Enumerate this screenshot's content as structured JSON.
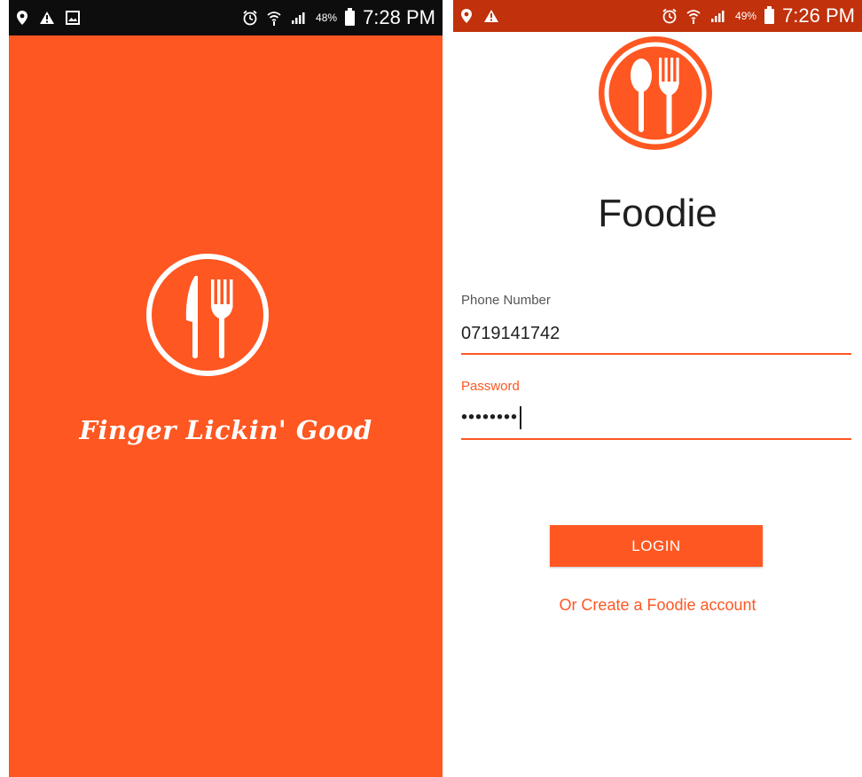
{
  "colors": {
    "accent": "#fe5722",
    "status_bar_dark": "#0d0d0d",
    "status_bar_accent": "#c0310c",
    "text_dark": "#1f1f1f"
  },
  "splash": {
    "status_bar": {
      "left_icons": [
        "location-icon",
        "warning-icon",
        "gallery-icon"
      ],
      "right_icons": [
        "alarm-icon",
        "wifi-icon",
        "signal-icon",
        "battery-icon"
      ],
      "battery": "48%",
      "time": "7:28 PM"
    },
    "logo_icon": "knife-fork-icon",
    "tagline": "Finger Lickin' Good"
  },
  "login": {
    "status_bar": {
      "left_icons": [
        "location-icon",
        "warning-icon"
      ],
      "right_icons": [
        "alarm-icon",
        "wifi-icon",
        "signal-icon",
        "battery-icon"
      ],
      "battery": "49%",
      "time": "7:26 PM"
    },
    "logo_icon": "spoon-fork-icon",
    "title": "Foodie",
    "phone": {
      "label": "Phone Number",
      "value": "0719141742"
    },
    "password": {
      "label": "Password",
      "value": "••••••••"
    },
    "login_button": "LOGIN",
    "create_account": "Or Create a Foodie account"
  }
}
